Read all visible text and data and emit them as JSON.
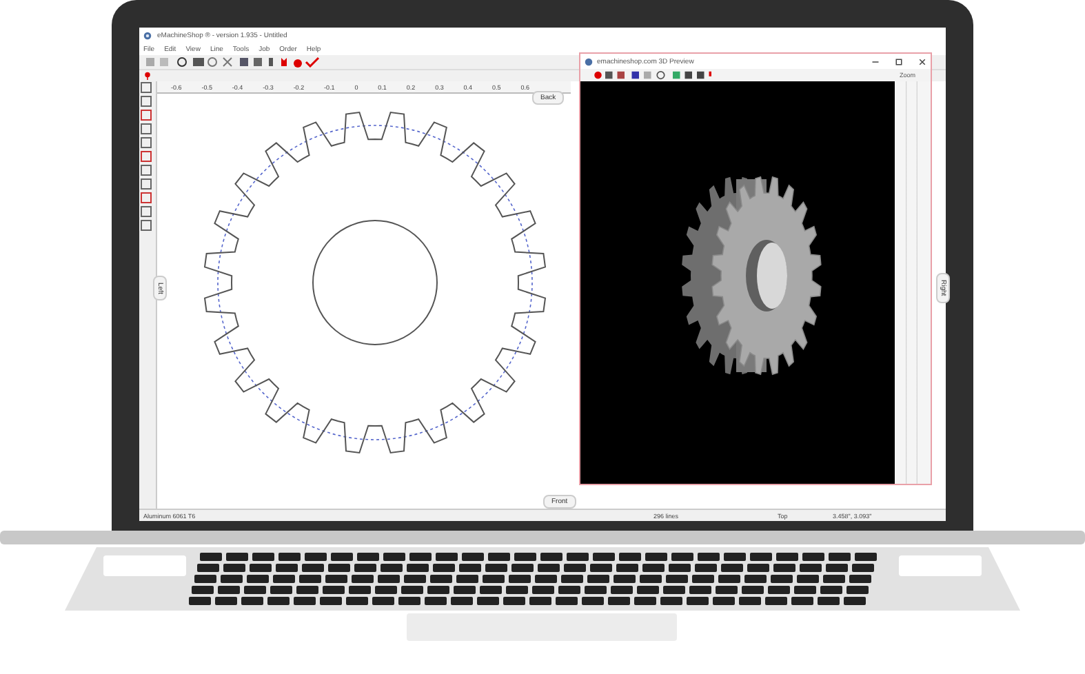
{
  "app": {
    "title": "eMachineShop ® - version 1.935 - Untitled",
    "menu": [
      "File",
      "Edit",
      "View",
      "Line",
      "Tools",
      "Job",
      "Order",
      "Help"
    ]
  },
  "ruler": {
    "ticks": [
      "-0.6",
      "-0.5",
      "-0.4",
      "-0.3",
      "-0.2",
      "-0.1",
      "0",
      "0.1",
      "0.2",
      "0.3",
      "0.4",
      "0.5",
      "0.6"
    ]
  },
  "views": {
    "back": "Back",
    "front": "Front",
    "left": "Left",
    "right": "Right"
  },
  "preview": {
    "title": "emachineshop.com 3D Preview",
    "zoom_label": "Zoom"
  },
  "status_bar": {
    "material": "Aluminum 6061 T6",
    "lines": "296 lines",
    "view": "Top",
    "position": "3.458\", 3.093\""
  }
}
